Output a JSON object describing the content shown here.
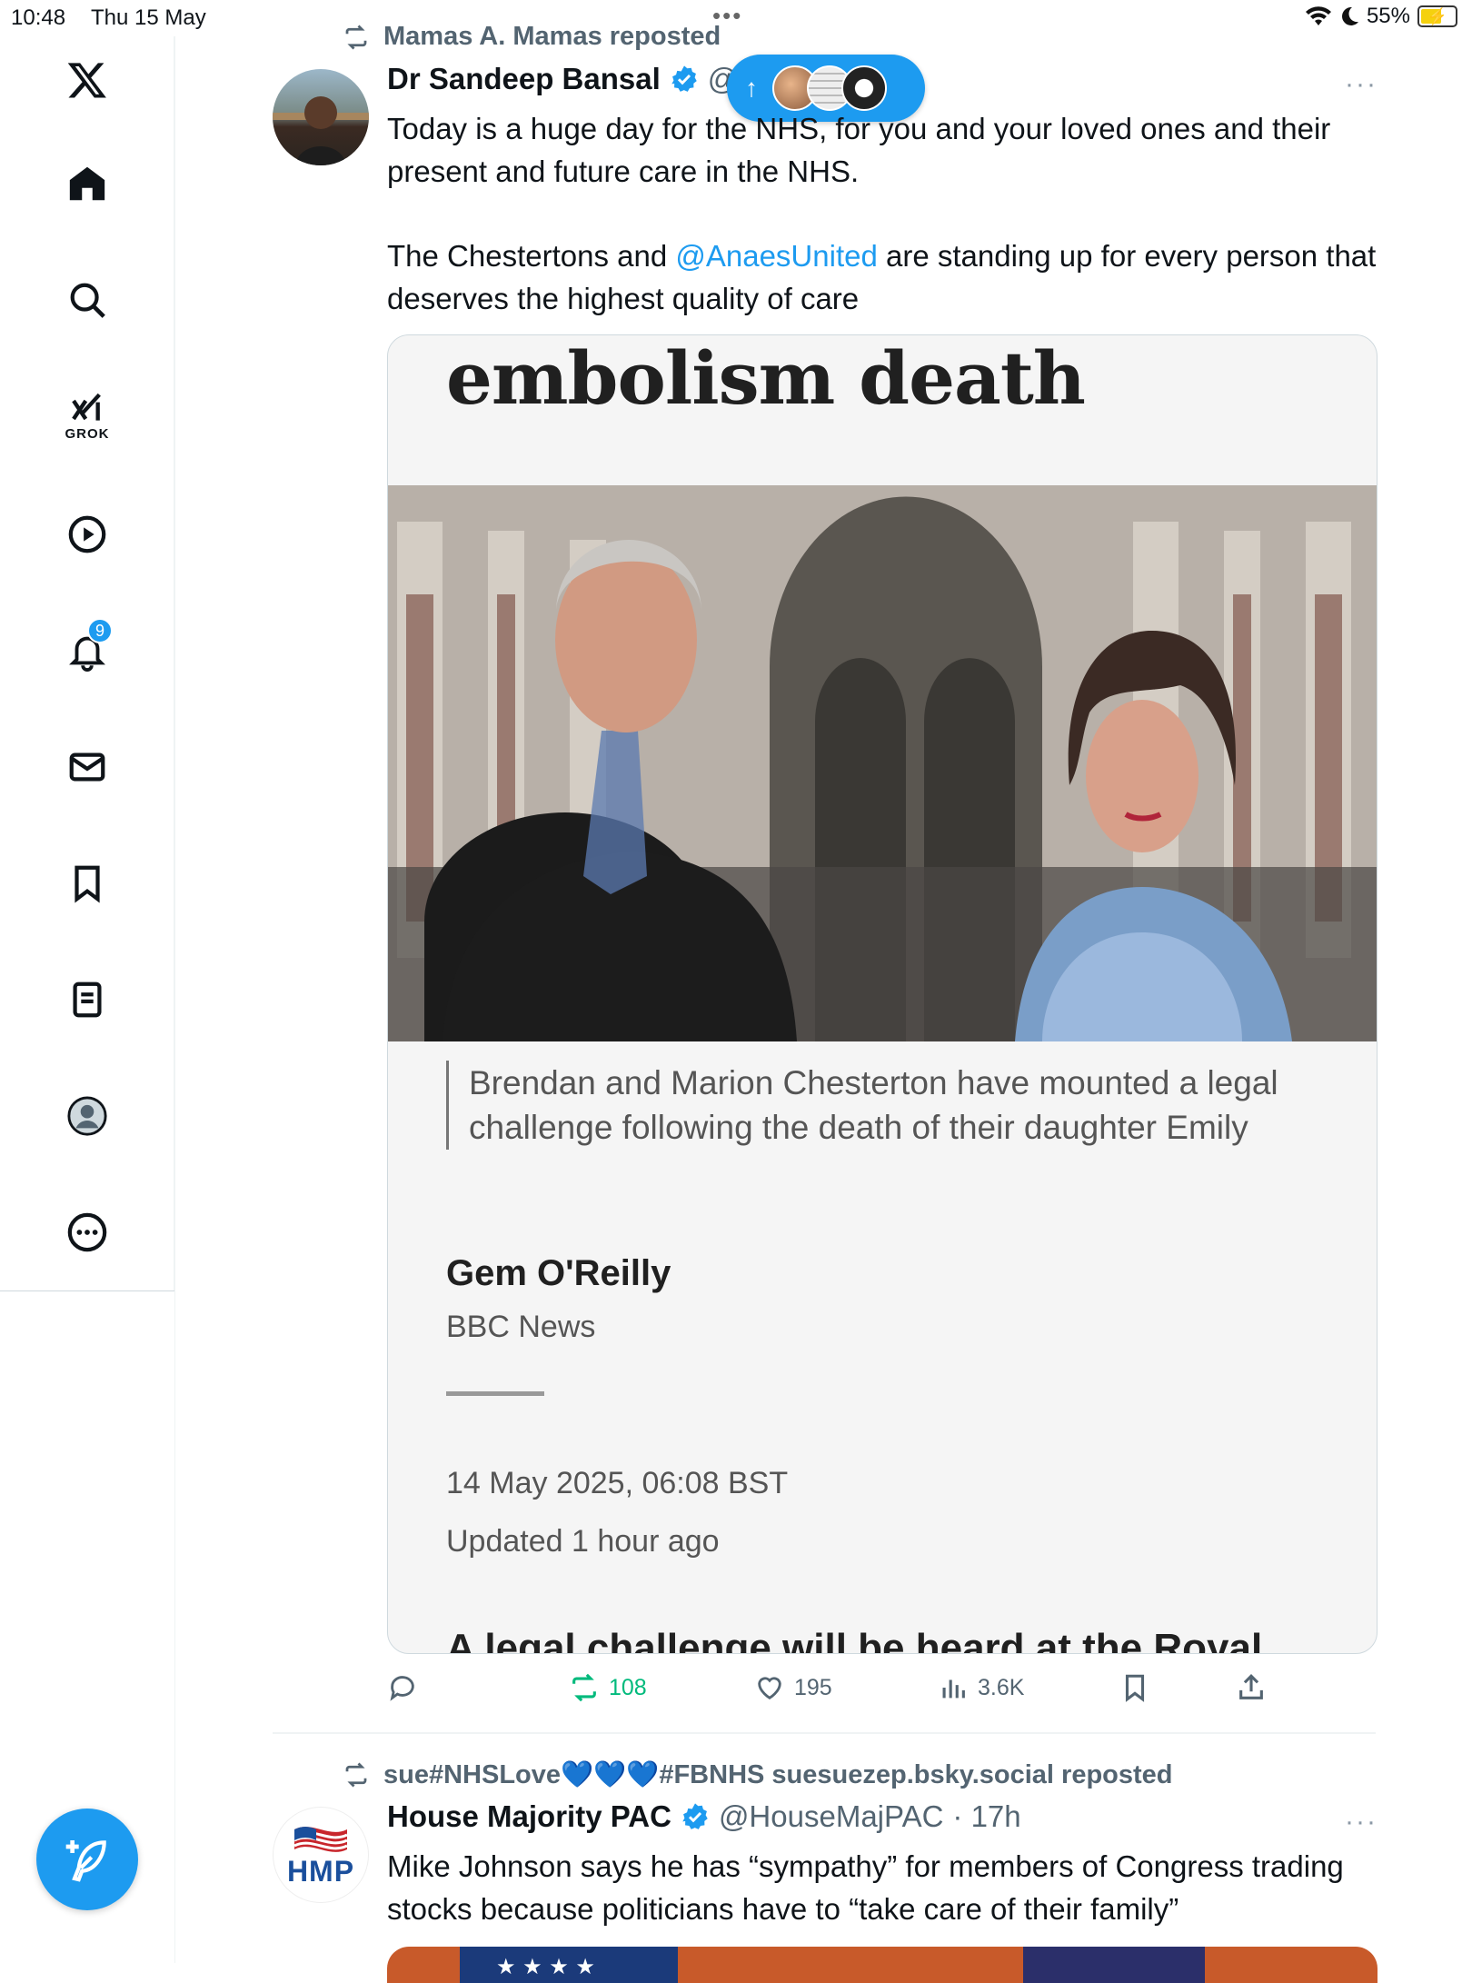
{
  "status_bar": {
    "time": "10:48",
    "date": "Thu 15 May",
    "battery": "55%"
  },
  "sidebar": {
    "grok_label": "GROK",
    "notifications_badge": "9",
    "items": [
      "home",
      "explore",
      "grok",
      "video",
      "notifications",
      "messages",
      "bookmarks",
      "lists",
      "profile",
      "more"
    ]
  },
  "tweets": [
    {
      "repost_by": "Mamas A. Mamas reposted",
      "author_name": "Dr Sandeep Bansal",
      "handle_partial": "@",
      "more": "···",
      "text_line1": "Today is a huge day for the NHS, for you and your loved ones and their present and future care in the NHS.",
      "text_p2_pre": "The Chestertons and ",
      "text_p2_mention": "@AnaesUnited",
      "text_p2_post": " are standing up for every person that deserves the highest quality of care",
      "card": {
        "headline": "embolism death",
        "caption": "Brendan and Marion Chesterton have mounted a legal challenge following the death of their daughter Emily",
        "author": "Gem O'Reilly",
        "outlet": "BBC News",
        "published": "14 May 2025, 06:08 BST",
        "updated": "Updated 1 hour ago",
        "next_heading": "A legal challenge will be heard at the Royal"
      },
      "metrics": {
        "replies": "",
        "reposts": "108",
        "likes": "195",
        "views": "3.6K"
      }
    },
    {
      "repost_by": "sue#NHSLove💙💙💙#FBNHS suesuezep.bsky.social reposted",
      "author_name": "House Majority PAC",
      "handle": "@HouseMajPAC",
      "time": "· 17h",
      "more": "···",
      "logo_text": "HMP",
      "text": "Mike Johnson says he has “sympathy” for members of Congress trading stocks because politicians have to “take care of their family”"
    }
  ],
  "colors": {
    "accent": "#1d9bf0",
    "repost_green": "#00ba7c",
    "muted": "#536471"
  }
}
